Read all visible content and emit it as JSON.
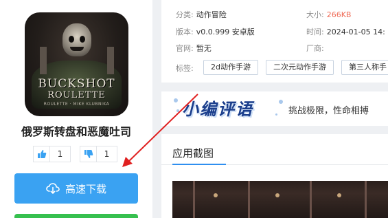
{
  "app": {
    "icon_title_line1": "BUCKSHOT",
    "icon_title_line2": "ROULETTE",
    "icon_title_line3": "ROULETTE · MIKE KLUBNIKA",
    "name": "俄罗斯转盘和恶魔吐司"
  },
  "votes": {
    "like_count": "1",
    "dislike_count": "1"
  },
  "download": {
    "label": "高速下载"
  },
  "info": {
    "category_label": "分类:",
    "category_value": "动作冒险",
    "size_label": "大小:",
    "size_value": "266KB",
    "version_label": "版本:",
    "version_value": "v0.0.999 安卓版",
    "time_label": "时间:",
    "time_value": "2024-01-05 14:",
    "website_label": "官网:",
    "website_value": "暂无",
    "vendor_label": "厂商:",
    "vendor_value": "",
    "tags_label": "标签:",
    "tags": [
      "2d动作手游",
      "二次元动作手游",
      "第三人称手"
    ]
  },
  "review": {
    "badge": "小编评语",
    "text": "挑战极限，性命相搏"
  },
  "screenshots": {
    "title": "应用截图"
  },
  "colors": {
    "download_blue": "#3aa2f2",
    "accent_blue": "#2f8ff0",
    "size_red": "#ef6a55",
    "annotation_red": "#e02020",
    "green_button": "#36c04f"
  }
}
